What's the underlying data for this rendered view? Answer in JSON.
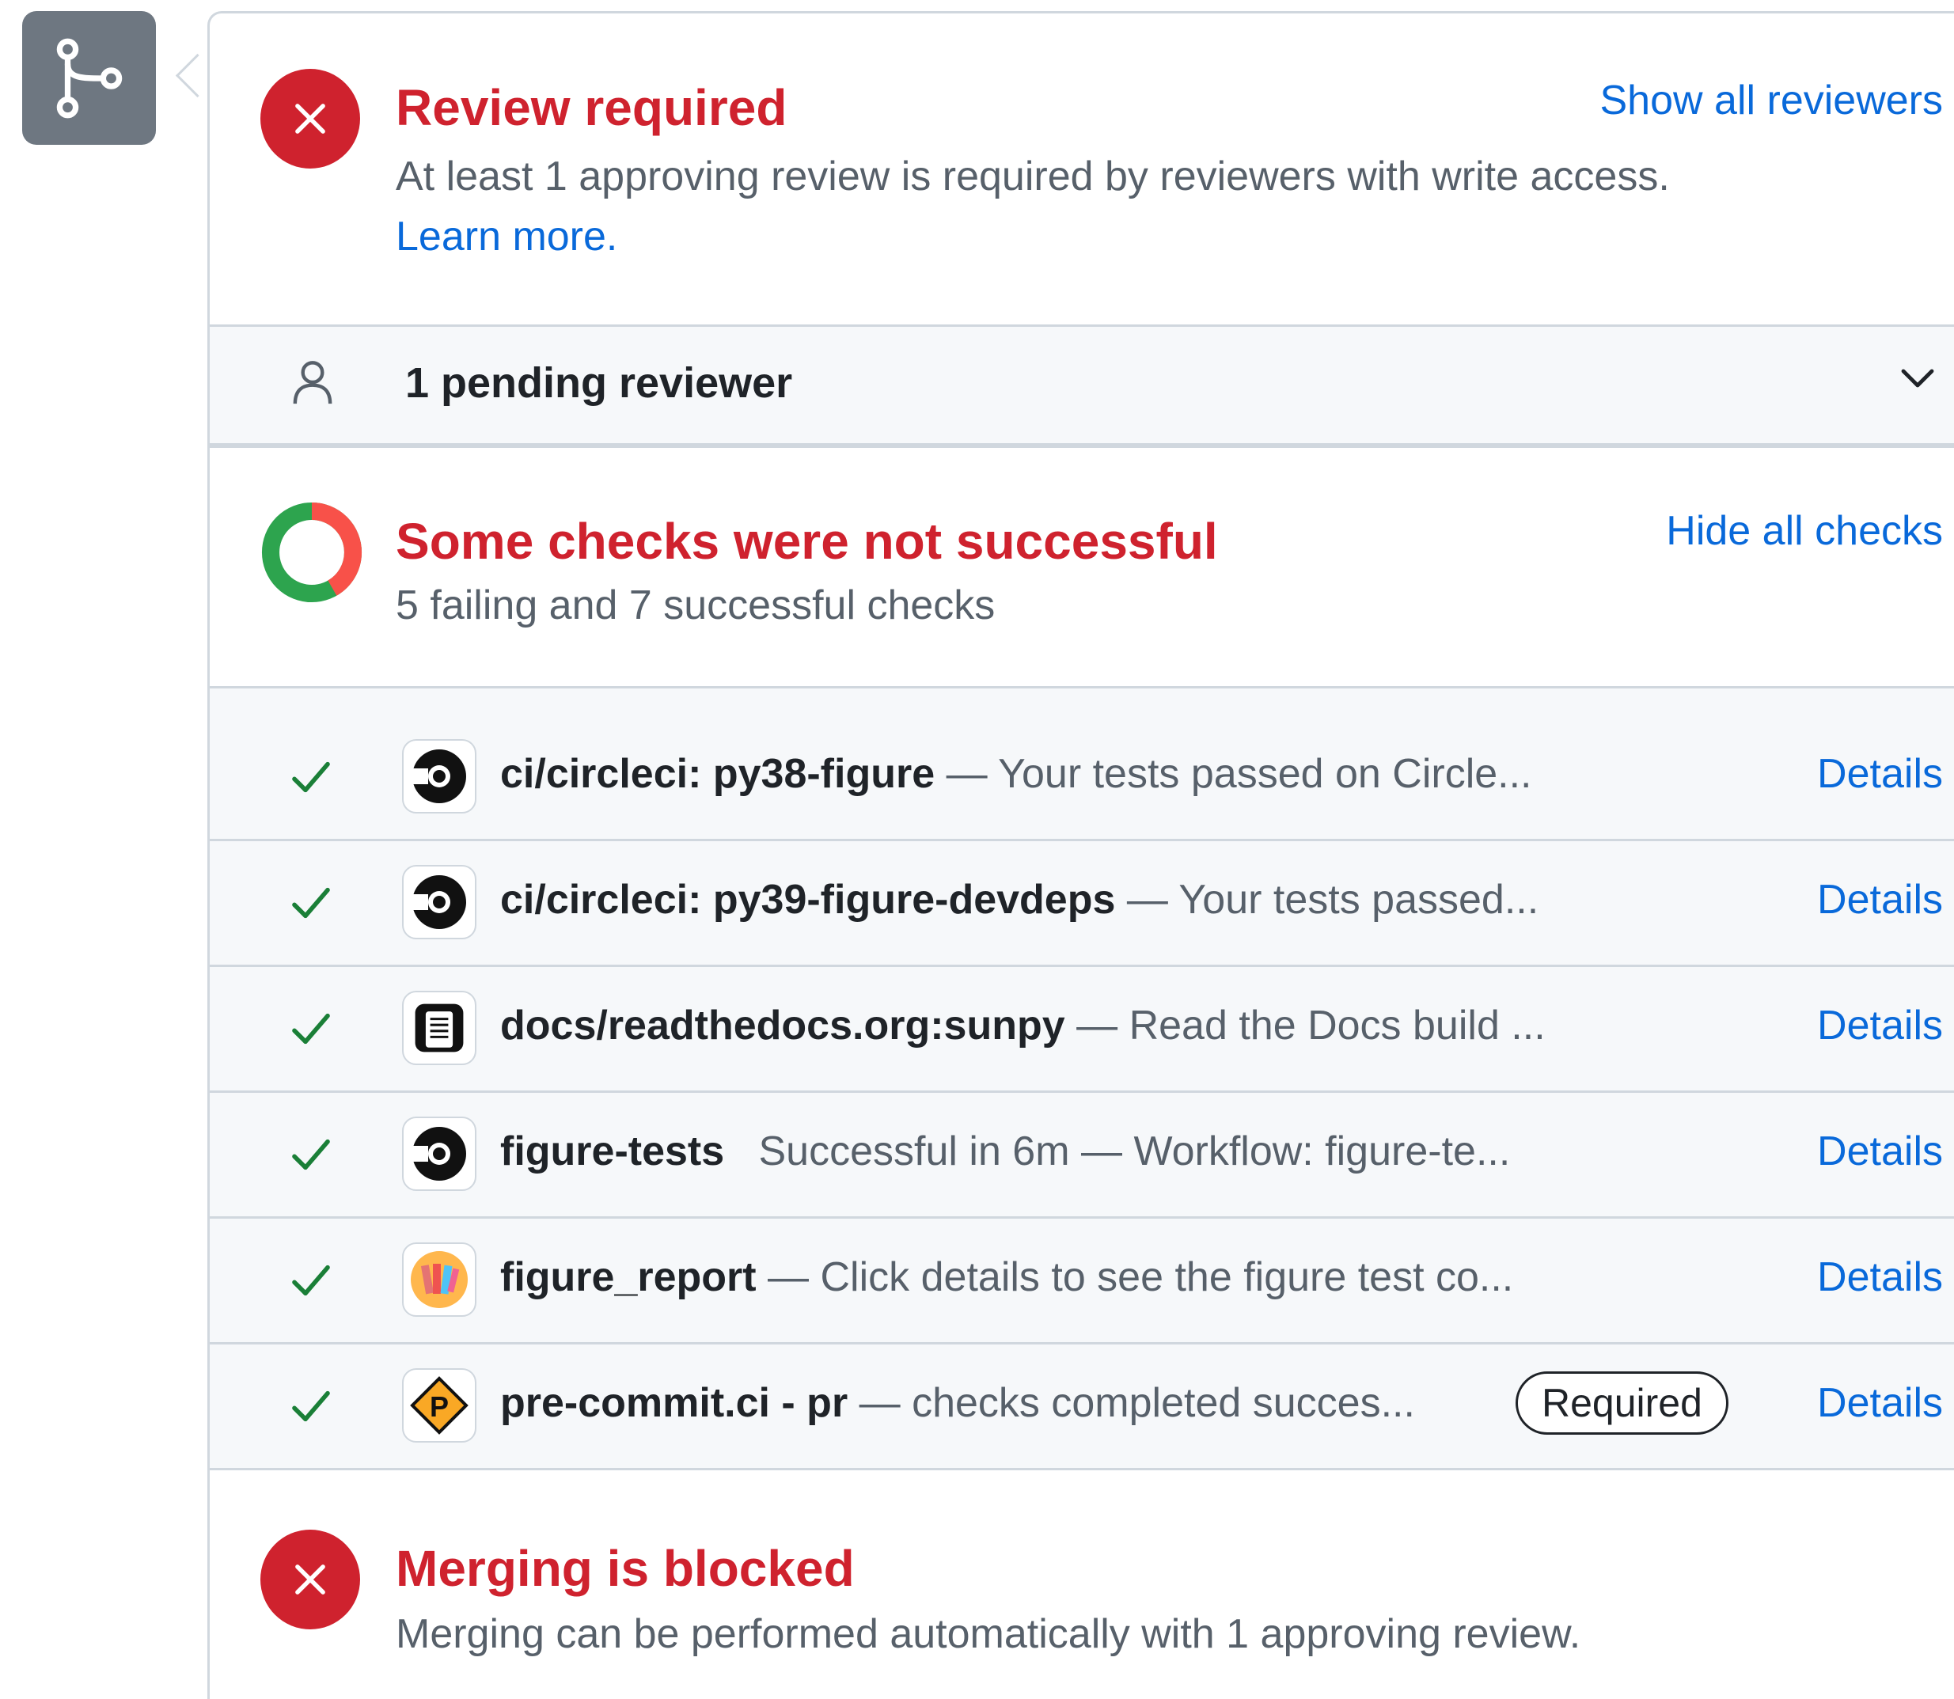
{
  "review": {
    "title": "Review required",
    "description": "At least 1 approving review is required by reviewers with write access.",
    "learn_more": "Learn more.",
    "show_all": "Show all reviewers"
  },
  "pending": {
    "label": "1 pending reviewer"
  },
  "checks": {
    "title": "Some checks were not successful",
    "summary": "5 failing and 7 successful checks",
    "hide_all": "Hide all checks",
    "failing_count": 5,
    "success_count": 7,
    "items": [
      {
        "name": "ci/circleci: py38-figure",
        "desc": " — Your tests passed on Circle...",
        "details": "Details",
        "icon": "circleci-icon"
      },
      {
        "name": "ci/circleci: py39-figure-devdeps",
        "desc": " — Your tests passed...",
        "details": "Details",
        "icon": "circleci-icon"
      },
      {
        "name": "docs/readthedocs.org:sunpy",
        "desc": " — Read the Docs build ...",
        "details": "Details",
        "icon": "readthedocs-icon"
      },
      {
        "name": "figure-tests",
        "desc": "   Successful in 6m — Workflow: figure-te...",
        "details": "Details",
        "icon": "circleci-icon"
      },
      {
        "name": "figure_report",
        "desc": " — Click details to see the figure test co...",
        "details": "Details",
        "icon": "figure-report-icon"
      },
      {
        "name": "pre-commit.ci - pr",
        "desc": " — checks completed succes...",
        "details": "Details",
        "icon": "precommit-icon",
        "badge": "Required"
      }
    ]
  },
  "merge": {
    "title": "Merging is blocked",
    "description": "Merging can be performed automatically with 1 approving review."
  },
  "colors": {
    "danger": "#cf222e",
    "success": "#1a7f37",
    "link": "#0969da",
    "muted": "#57606a",
    "failing_ring": "#f85149",
    "success_ring": "#2da44e"
  }
}
